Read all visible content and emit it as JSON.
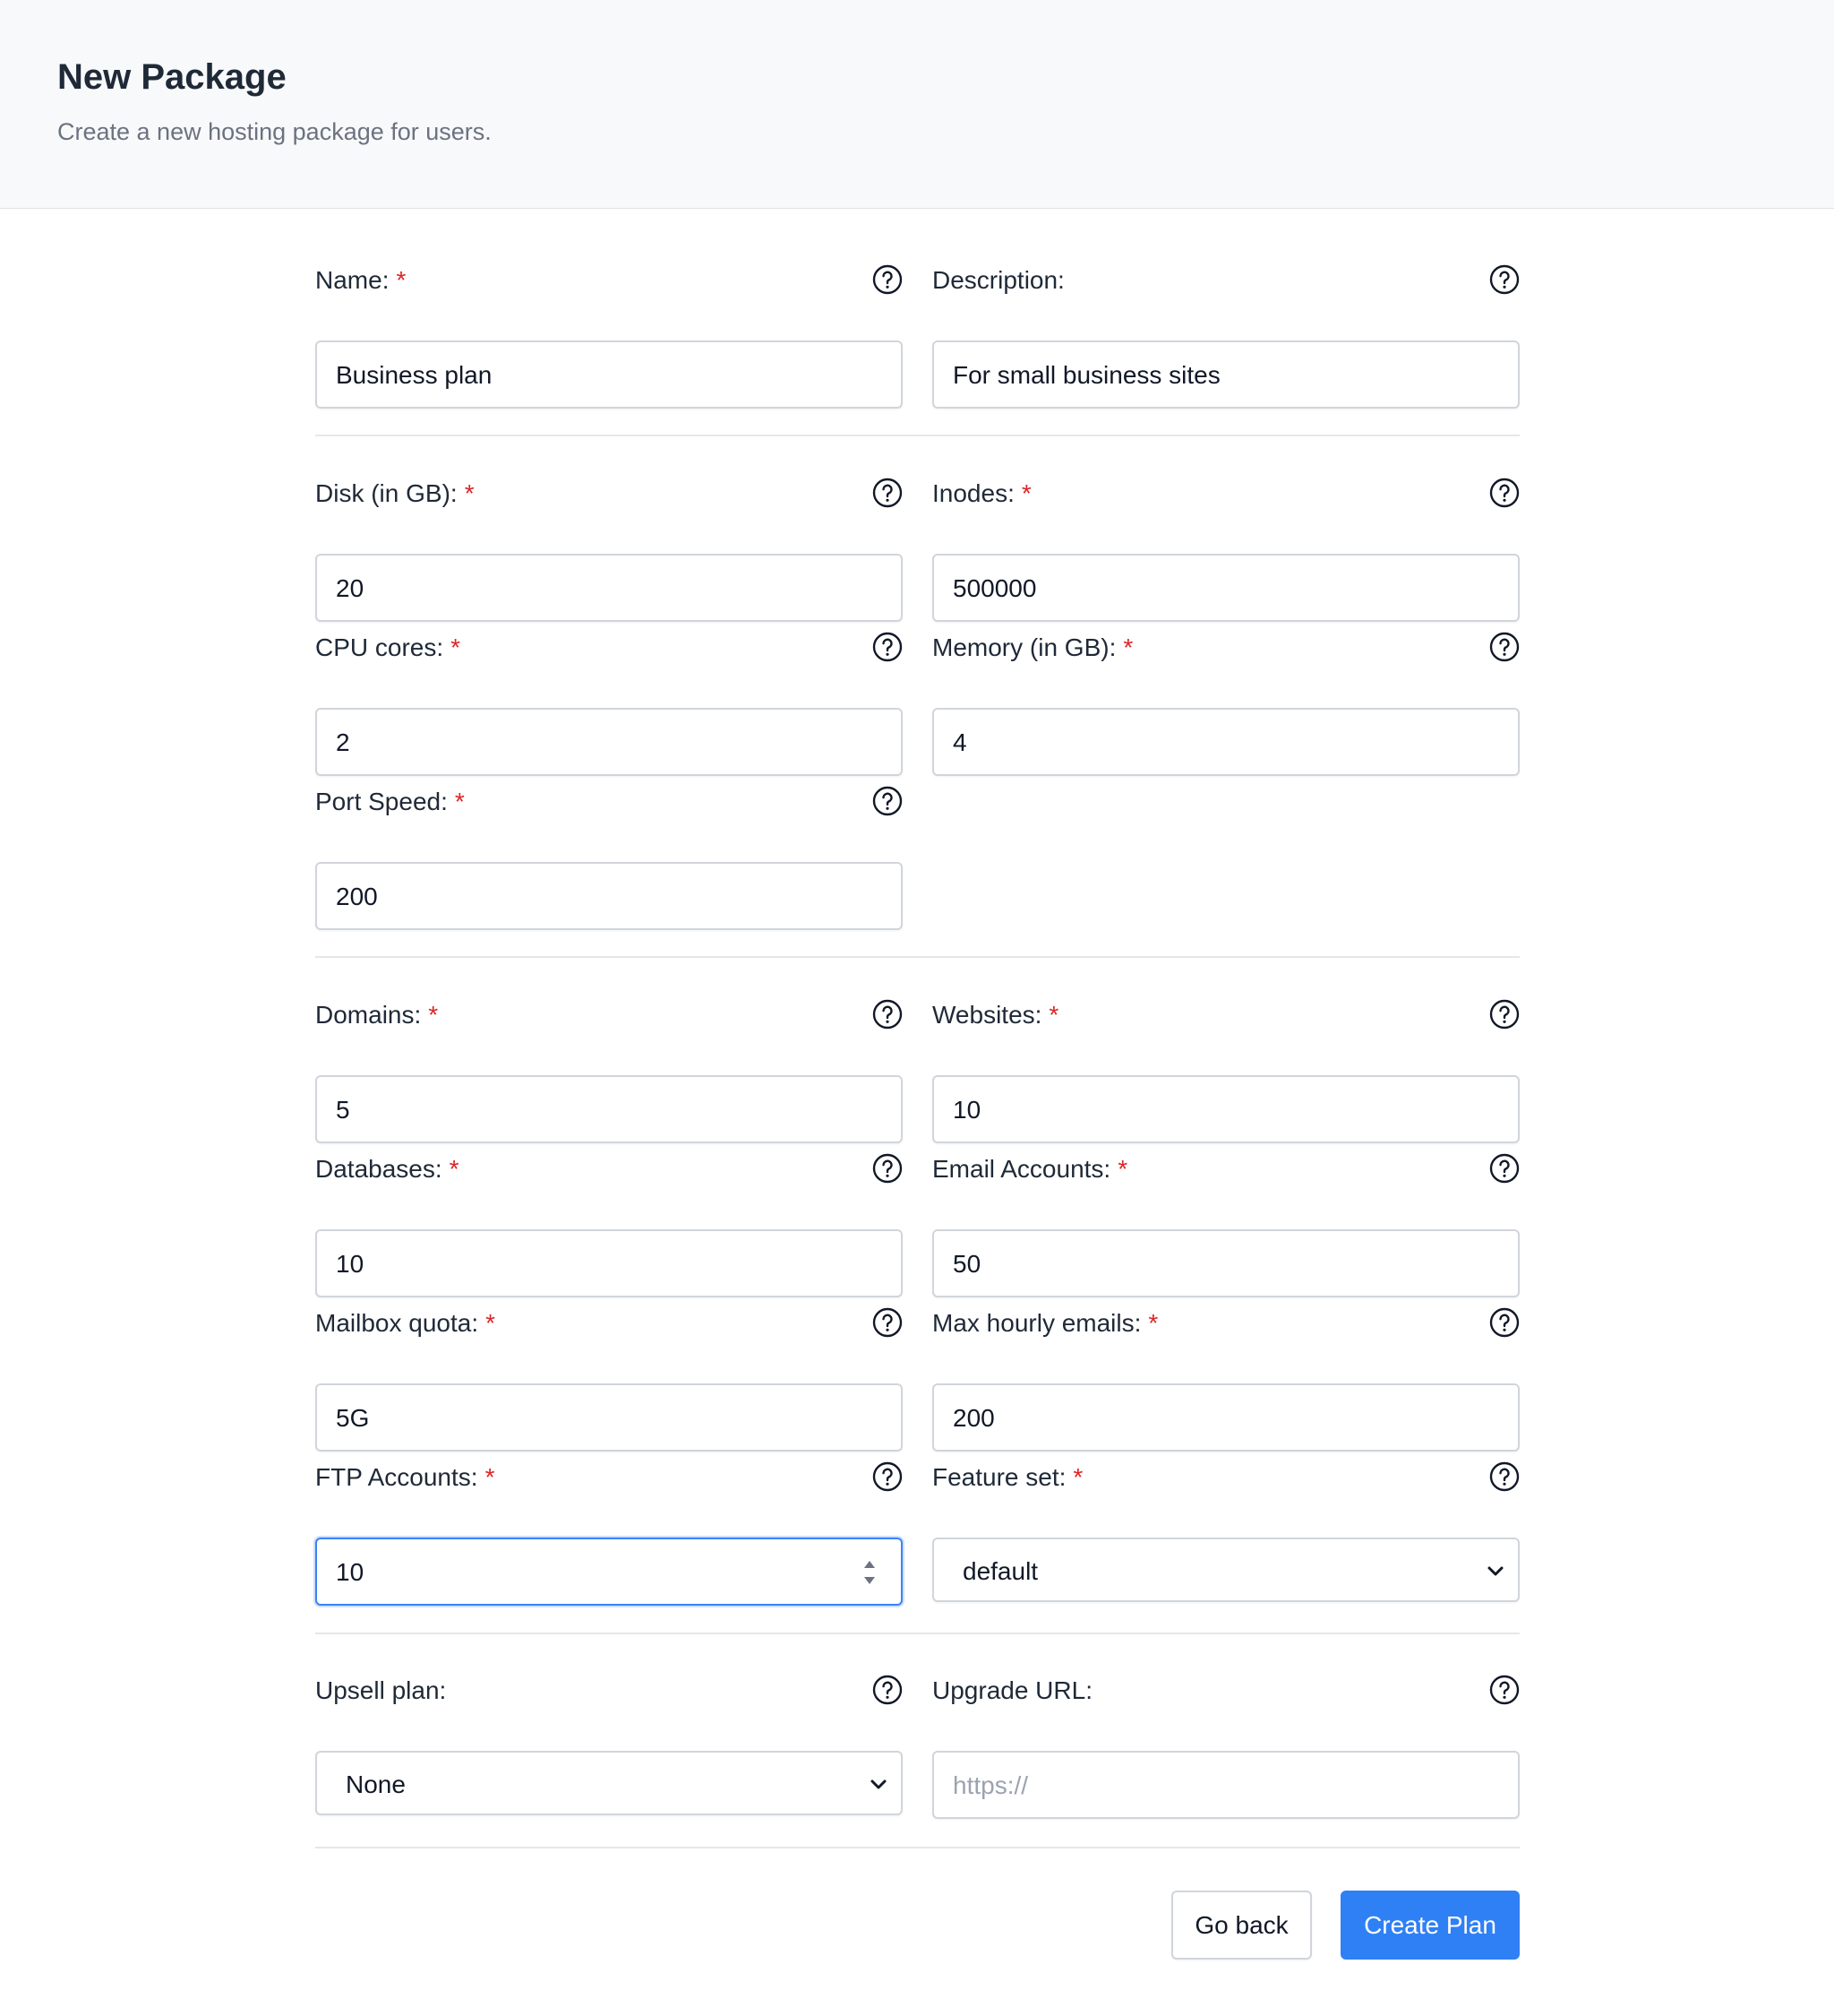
{
  "header": {
    "title": "New Package",
    "subtitle": "Create a new hosting package for users."
  },
  "required_mark": "*",
  "fields": {
    "name": {
      "label": "Name:",
      "value": "Business plan"
    },
    "description": {
      "label": "Description:",
      "value": "For small business sites"
    },
    "disk": {
      "label": "Disk (in GB):",
      "value": "20"
    },
    "inodes": {
      "label": "Inodes:",
      "value": "500000"
    },
    "cpu": {
      "label": "CPU cores:",
      "value": "2"
    },
    "memory": {
      "label": "Memory (in GB):",
      "value": "4"
    },
    "port_speed": {
      "label": "Port Speed:",
      "value": "200"
    },
    "domains": {
      "label": "Domains:",
      "value": "5"
    },
    "websites": {
      "label": "Websites:",
      "value": "10"
    },
    "databases": {
      "label": "Databases:",
      "value": "10"
    },
    "email_accounts": {
      "label": "Email Accounts:",
      "value": "50"
    },
    "mailbox_quota": {
      "label": "Mailbox quota:",
      "value": "5G"
    },
    "max_hourly_emails": {
      "label": "Max hourly emails:",
      "value": "200"
    },
    "ftp_accounts": {
      "label": "FTP Accounts:",
      "value": "10"
    },
    "feature_set": {
      "label": "Feature set:",
      "value": "default"
    },
    "upsell_plan": {
      "label": "Upsell plan:",
      "value": "None"
    },
    "upgrade_url": {
      "label": "Upgrade URL:",
      "value": "",
      "placeholder": "https://"
    }
  },
  "buttons": {
    "back": "Go back",
    "create": "Create Plan"
  },
  "colors": {
    "accent": "#2f80f5",
    "required": "#dc2626",
    "focus": "#3b82f6"
  },
  "icons": {
    "help": "question-circle-icon",
    "dropdown": "chevron-down-icon",
    "spinner": "number-spinner-icon"
  }
}
